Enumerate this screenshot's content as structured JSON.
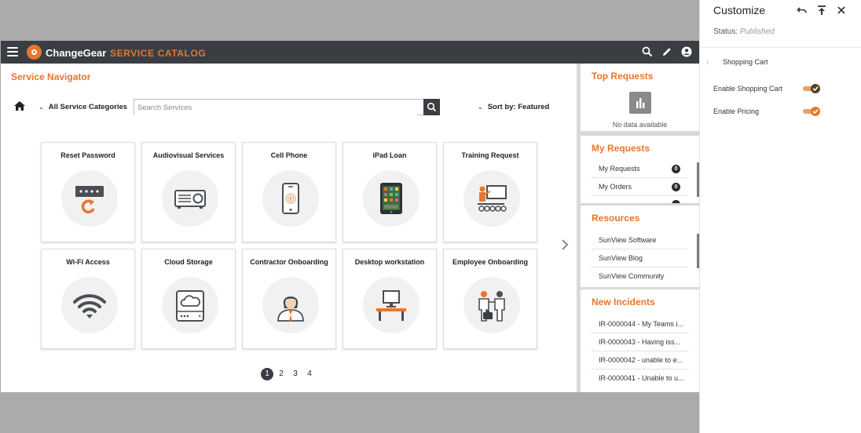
{
  "app": {
    "brand": "ChangeGear",
    "module": "SERVICE CATALOG",
    "accent": "#e8762d",
    "topbar_color": "#3a3e43"
  },
  "navigator": {
    "title": "Service Navigator",
    "category_dropdown": "All Service Categories",
    "search_placeholder": "Search Services",
    "sort_dropdown": "Sort by: Featured"
  },
  "services": [
    {
      "label": "Reset Password",
      "icon": "password-reset-icon"
    },
    {
      "label": "Audiovisual Services",
      "icon": "projector-icon"
    },
    {
      "label": "Cell Phone",
      "icon": "cell-phone-icon"
    },
    {
      "label": "iPad Loan",
      "icon": "ipad-icon"
    },
    {
      "label": "Training Request",
      "icon": "training-icon"
    },
    {
      "label": "Wi-Fi Access",
      "icon": "wifi-icon"
    },
    {
      "label": "Cloud Storage",
      "icon": "cloud-storage-icon"
    },
    {
      "label": "Contractor Onboarding",
      "icon": "contractor-icon"
    },
    {
      "label": "Desktop workstation",
      "icon": "desktop-icon"
    },
    {
      "label": "Employee Onboarding",
      "icon": "employee-onboarding-icon"
    }
  ],
  "pagination": {
    "pages": [
      "1",
      "2",
      "3",
      "4"
    ],
    "current": "1"
  },
  "widgets": {
    "top_requests": {
      "title": "Top Requests",
      "empty_text": "No data available"
    },
    "my_requests": {
      "title": "My Requests",
      "items": [
        {
          "label": "My Requests",
          "count": "0"
        },
        {
          "label": "My Orders",
          "count": "0"
        }
      ]
    },
    "resources": {
      "title": "Resources",
      "items": [
        "SunView Software",
        "SunView Blog",
        "SunView Community"
      ]
    },
    "new_incidents": {
      "title": "New Incidents",
      "items": [
        "IR-0000044 - My Teams i...",
        "IR-0000043 - Having iss...",
        "IR-0000042 - unable to e...",
        "IR-0000041 - Unable to u..."
      ]
    }
  },
  "customize_panel": {
    "title": "Customize",
    "status_label": "Status:",
    "status_value": "Published",
    "section": "Shopping Cart",
    "settings": [
      {
        "label": "Enable Shopping Cart",
        "enabled": true
      },
      {
        "label": "Enable Pricing",
        "enabled": true
      }
    ]
  }
}
